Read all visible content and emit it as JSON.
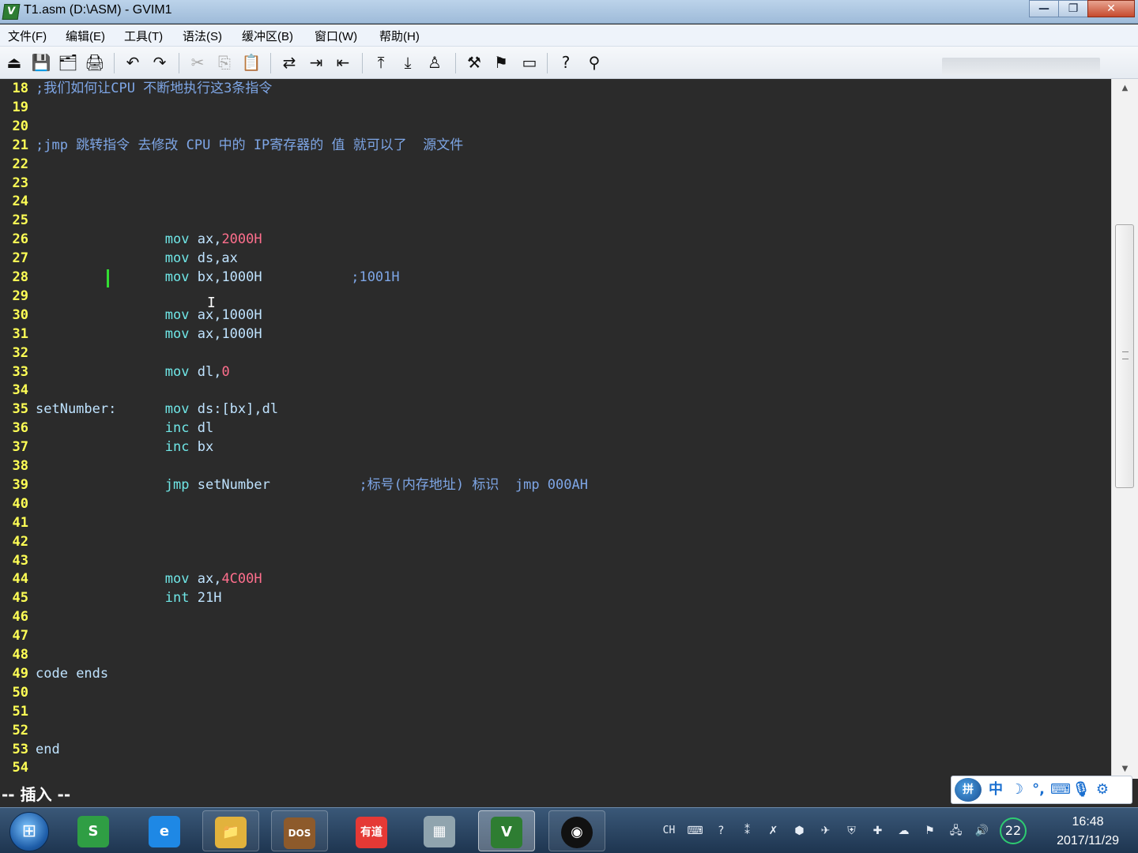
{
  "window": {
    "title": "T1.asm (D:\\ASM) - GVIM1",
    "minimize_label": "—",
    "restore_label": "❐",
    "close_label": "✕"
  },
  "menu": [
    {
      "label": "文件(F)"
    },
    {
      "label": "编辑(E)"
    },
    {
      "label": "工具(T)"
    },
    {
      "label": "语法(S)"
    },
    {
      "label": "缓冲区(B)"
    },
    {
      "label": "窗口(W)"
    },
    {
      "label": "帮助(H)"
    }
  ],
  "toolbar": [
    {
      "icon": "open-icon",
      "glyph": "⏏"
    },
    {
      "icon": "save-icon",
      "glyph": "💾"
    },
    {
      "icon": "save-all-icon",
      "glyph": "🗂"
    },
    {
      "icon": "print-icon",
      "glyph": "🖨"
    },
    {
      "icon": "undo-icon",
      "glyph": "↶"
    },
    {
      "icon": "redo-icon",
      "glyph": "↷"
    },
    {
      "icon": "cut-icon",
      "glyph": "✂"
    },
    {
      "icon": "copy-icon",
      "glyph": "⎘"
    },
    {
      "icon": "paste-icon",
      "glyph": "📋"
    },
    {
      "icon": "replace-icon",
      "glyph": "⇄"
    },
    {
      "icon": "find-next-icon",
      "glyph": "⇥"
    },
    {
      "icon": "find-prev-icon",
      "glyph": "⇤"
    },
    {
      "icon": "load-session-icon",
      "glyph": "⤒"
    },
    {
      "icon": "save-session-icon",
      "glyph": "⤓"
    },
    {
      "icon": "run-script-icon",
      "glyph": "♙"
    },
    {
      "icon": "make-icon",
      "glyph": "⚒"
    },
    {
      "icon": "shell-icon",
      "glyph": "⚑"
    },
    {
      "icon": "ctags-icon",
      "glyph": "▭"
    },
    {
      "icon": "help-icon",
      "glyph": "?"
    },
    {
      "icon": "find-help-icon",
      "glyph": "⚲"
    }
  ],
  "editor": {
    "lines": [
      {
        "n": "18",
        "tokens": [
          {
            "t": ";我们如何让CPU 不断地执行这3条指令",
            "c": "comment"
          }
        ]
      },
      {
        "n": "19",
        "tokens": []
      },
      {
        "n": "20",
        "tokens": []
      },
      {
        "n": "21",
        "tokens": [
          {
            "t": ";jmp 跳转指令 去修改 CPU 中的 IP寄存器的 值 就可以了  源文件",
            "c": "comment"
          }
        ]
      },
      {
        "n": "22",
        "tokens": []
      },
      {
        "n": "23",
        "tokens": []
      },
      {
        "n": "24",
        "tokens": []
      },
      {
        "n": "25",
        "tokens": []
      },
      {
        "n": "26",
        "tokens": [
          {
            "t": "                ",
            "c": ""
          },
          {
            "t": "mov",
            "c": "kw"
          },
          {
            "t": " ax,",
            "c": "label"
          },
          {
            "t": "2000H",
            "c": "num"
          }
        ]
      },
      {
        "n": "27",
        "tokens": [
          {
            "t": "                ",
            "c": ""
          },
          {
            "t": "mov",
            "c": "kw"
          },
          {
            "t": " ds,ax",
            "c": "label"
          }
        ]
      },
      {
        "n": "28",
        "tokens": [
          {
            "t": "                ",
            "c": ""
          },
          {
            "t": "mov",
            "c": "kw"
          },
          {
            "t": " bx,",
            "c": "label"
          },
          {
            "t": "1000H",
            "c": "num2"
          },
          {
            "t": "           ",
            "c": ""
          },
          {
            "t": ";1001H",
            "c": "comment"
          }
        ]
      },
      {
        "n": "29",
        "tokens": []
      },
      {
        "n": "30",
        "tokens": [
          {
            "t": "                ",
            "c": ""
          },
          {
            "t": "mov",
            "c": "kw"
          },
          {
            "t": " ax,",
            "c": "label"
          },
          {
            "t": "1000H",
            "c": "num2"
          }
        ]
      },
      {
        "n": "31",
        "tokens": [
          {
            "t": "                ",
            "c": ""
          },
          {
            "t": "mov",
            "c": "kw"
          },
          {
            "t": " ax,",
            "c": "label"
          },
          {
            "t": "1000H",
            "c": "num2"
          }
        ]
      },
      {
        "n": "32",
        "tokens": []
      },
      {
        "n": "33",
        "tokens": [
          {
            "t": "                ",
            "c": ""
          },
          {
            "t": "mov",
            "c": "kw"
          },
          {
            "t": " dl,",
            "c": "label"
          },
          {
            "t": "0",
            "c": "num"
          }
        ]
      },
      {
        "n": "34",
        "tokens": []
      },
      {
        "n": "35",
        "tokens": [
          {
            "t": "setNumber:",
            "c": "label"
          },
          {
            "t": "      ",
            "c": ""
          },
          {
            "t": "mov",
            "c": "kw"
          },
          {
            "t": " ds:[bx],dl",
            "c": "label"
          }
        ]
      },
      {
        "n": "36",
        "tokens": [
          {
            "t": "                ",
            "c": ""
          },
          {
            "t": "inc",
            "c": "kw"
          },
          {
            "t": " dl",
            "c": "label"
          }
        ]
      },
      {
        "n": "37",
        "tokens": [
          {
            "t": "                ",
            "c": ""
          },
          {
            "t": "inc",
            "c": "kw"
          },
          {
            "t": " bx",
            "c": "label"
          }
        ]
      },
      {
        "n": "38",
        "tokens": []
      },
      {
        "n": "39",
        "tokens": [
          {
            "t": "                ",
            "c": ""
          },
          {
            "t": "jmp",
            "c": "kw"
          },
          {
            "t": " setNumber",
            "c": "label"
          },
          {
            "t": "           ",
            "c": ""
          },
          {
            "t": ";标号(内存地址) 标识  jmp 000AH",
            "c": "comment"
          }
        ]
      },
      {
        "n": "40",
        "tokens": []
      },
      {
        "n": "41",
        "tokens": []
      },
      {
        "n": "42",
        "tokens": []
      },
      {
        "n": "43",
        "tokens": []
      },
      {
        "n": "44",
        "tokens": [
          {
            "t": "                ",
            "c": ""
          },
          {
            "t": "mov",
            "c": "kw"
          },
          {
            "t": " ax,",
            "c": "label"
          },
          {
            "t": "4C00H",
            "c": "num"
          }
        ]
      },
      {
        "n": "45",
        "tokens": [
          {
            "t": "                ",
            "c": ""
          },
          {
            "t": "int",
            "c": "kw"
          },
          {
            "t": " 21H",
            "c": "label"
          }
        ]
      },
      {
        "n": "46",
        "tokens": []
      },
      {
        "n": "47",
        "tokens": []
      },
      {
        "n": "48",
        "tokens": []
      },
      {
        "n": "49",
        "tokens": [
          {
            "t": "code",
            "c": "label"
          },
          {
            "t": " ends",
            "c": "label"
          }
        ]
      },
      {
        "n": "50",
        "tokens": []
      },
      {
        "n": "51",
        "tokens": []
      },
      {
        "n": "52",
        "tokens": []
      },
      {
        "n": "53",
        "tokens": [
          {
            "t": "end",
            "c": "label"
          }
        ]
      },
      {
        "n": "54",
        "tokens": []
      }
    ]
  },
  "statusline": {
    "mode": "-- 插入 --"
  },
  "ime": {
    "logo": "拼",
    "items": [
      {
        "icon": "chinese-mode-icon",
        "glyph": "中"
      },
      {
        "icon": "half-width-icon",
        "glyph": "☽"
      },
      {
        "icon": "punctuation-icon",
        "glyph": "°,"
      },
      {
        "icon": "keyboard-icon",
        "glyph": "⌨"
      },
      {
        "icon": "microphone-icon",
        "glyph": "🎙"
      },
      {
        "icon": "settings-icon",
        "glyph": "⚙"
      }
    ]
  },
  "taskbar": {
    "start_glyph": "⊞",
    "apps": [
      {
        "name": "app-sogou",
        "glyph": "S",
        "color": "#2f9e44"
      },
      {
        "name": "app-ie",
        "glyph": "e",
        "color": "#1e88e5"
      },
      {
        "name": "app-explorer",
        "glyph": "📁",
        "color": "#e2b23c"
      },
      {
        "name": "app-dosbox",
        "glyph": "DOS",
        "color": "#8d5a2b"
      },
      {
        "name": "app-youdao",
        "glyph": "有道",
        "color": "#e53935"
      },
      {
        "name": "app-calculator",
        "glyph": "▦",
        "color": "#90a4ae"
      },
      {
        "name": "app-gvim",
        "glyph": "V",
        "color": "#2e7d32"
      },
      {
        "name": "app-obs",
        "glyph": "◉",
        "color": "#111111"
      }
    ],
    "tray": {
      "lang": "CH",
      "badge": "22",
      "time": "16:48",
      "date": "2017/11/29"
    }
  }
}
